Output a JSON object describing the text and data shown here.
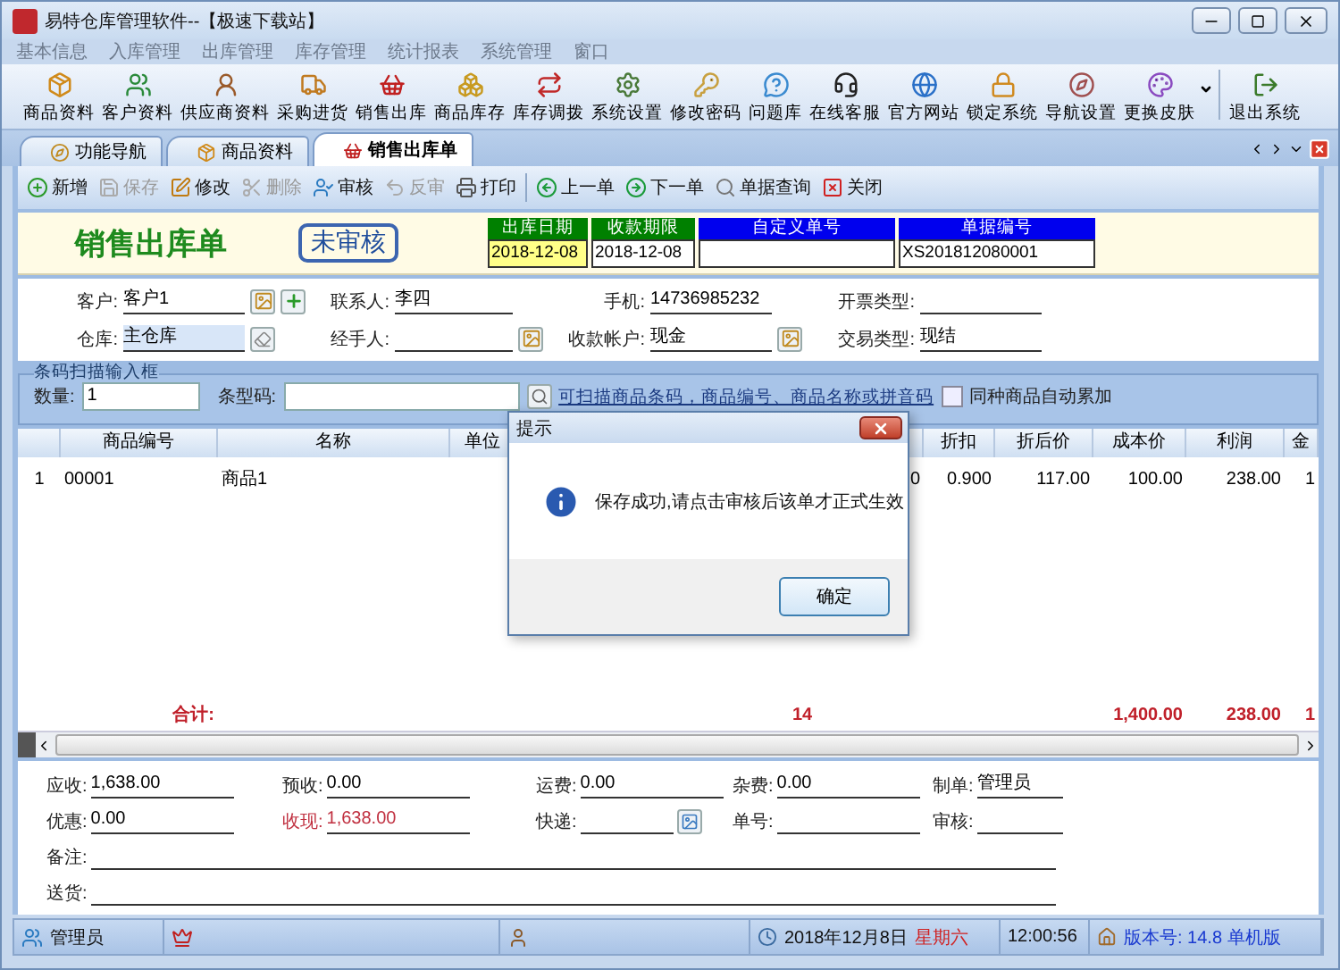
{
  "window": {
    "title": "易特仓库管理软件--【极速下载站】"
  },
  "menu": [
    "基本信息",
    "入库管理",
    "出库管理",
    "库存管理",
    "统计报表",
    "系统管理",
    "窗口"
  ],
  "toolbar_groups": [
    [
      {
        "label": "商品资料",
        "dropdown": false
      },
      {
        "label": "客户资料",
        "dropdown": false
      },
      {
        "label": "供应商资料",
        "dropdown": false
      },
      {
        "label": "采购进货",
        "dropdown": false
      },
      {
        "label": "销售出库",
        "dropdown": false
      },
      {
        "label": "商品库存",
        "dropdown": false
      },
      {
        "label": "库存调拨",
        "dropdown": false
      },
      {
        "label": "系统设置",
        "dropdown": false
      },
      {
        "label": "修改密码",
        "dropdown": false
      },
      {
        "label": "问题库",
        "dropdown": false
      },
      {
        "label": "在线客服",
        "dropdown": false
      },
      {
        "label": "官方网站",
        "dropdown": false
      },
      {
        "label": "锁定系统",
        "dropdown": false
      },
      {
        "label": "导航设置",
        "dropdown": false
      },
      {
        "label": "更换皮肤",
        "dropdown": true
      }
    ],
    [
      {
        "label": "退出系统",
        "dropdown": false
      }
    ]
  ],
  "tabs": [
    {
      "label": "功能导航",
      "selected": false
    },
    {
      "label": "商品资料",
      "selected": false
    },
    {
      "label": "销售出库单",
      "selected": true
    }
  ],
  "action_groups": [
    [
      {
        "label": "新增",
        "disabled": false
      },
      {
        "label": "保存",
        "disabled": true
      },
      {
        "label": "修改",
        "disabled": false
      },
      {
        "label": "删除",
        "disabled": true
      },
      {
        "label": "审核",
        "disabled": false
      },
      {
        "label": "反审",
        "disabled": true
      },
      {
        "label": "打印",
        "disabled": false
      }
    ],
    [
      {
        "label": "上一单",
        "disabled": false
      },
      {
        "label": "下一单",
        "disabled": false
      },
      {
        "label": "单据查询",
        "disabled": false
      },
      {
        "label": "关闭",
        "disabled": false
      }
    ]
  ],
  "form_title": "销售出库单",
  "stamp": "未审核",
  "header_fields": [
    {
      "label": "出库日期",
      "color": "#008000",
      "value": "2018-12-08",
      "focused": true
    },
    {
      "label": "收款期限",
      "color": "#008000",
      "value": "2018-12-08",
      "focused": false
    },
    {
      "label": "自定义单号",
      "color": "#0000ee",
      "focused": false
    },
    {
      "label": "单据编号",
      "color": "#0000ee",
      "value": "XS201812080001",
      "focused": false
    }
  ],
  "info_rows": [
    [
      {
        "label": "客户:",
        "value": "客户1",
        "highlighted": false
      },
      {
        "label": "联系人:",
        "value": "李四",
        "highlighted": false
      },
      {
        "label": "手机:",
        "value": "14736985232",
        "highlighted": false
      },
      {
        "label": "开票类型:",
        "highlighted": false
      }
    ],
    [
      {
        "label": "仓库:",
        "value": "主仓库",
        "highlighted": true
      },
      {
        "label": "经手人:",
        "highlighted": false
      },
      {
        "label": "收款帐户:",
        "value": "现金",
        "highlighted": false
      },
      {
        "label": "交易类型:",
        "value": "现结",
        "highlighted": false
      }
    ]
  ],
  "barcode": {
    "legend": "条码扫描输入框",
    "quantity_label": "数量:",
    "quantity": "1",
    "code_label": "条型码:",
    "hint": "可扫描商品条码，商品编号、商品名称或拼音码",
    "auto_merge": {
      "label": "同种商品自动累加",
      "checked": false
    }
  },
  "table": {
    "columns": [
      "商品编号",
      "名称",
      "单位",
      "折扣",
      "折后价",
      "成本价",
      "利润",
      "金"
    ],
    "rows": [
      {
        "number": "1",
        "cells": [
          "00001",
          "商品1"
        ],
        "trailing_cells": [
          "0",
          "0.900",
          "117.00",
          "100.00",
          "238.00",
          "1"
        ]
      }
    ],
    "totals": {
      "label": "合计:",
      "column_6": "14",
      "trailing_cells": [
        "1,400.00",
        "238.00",
        "1"
      ]
    }
  },
  "summary_rows": [
    [
      {
        "label": "应收:",
        "value": "1,638.00",
        "alert": false
      },
      {
        "label": "预收:",
        "value": "0.00",
        "alert": false
      },
      {
        "label": "运费:",
        "value": "0.00",
        "alert": false
      },
      {
        "label": "杂费:",
        "value": "0.00",
        "alert": false
      },
      {
        "label": "制单:",
        "value": "管理员",
        "alert": false
      }
    ],
    [
      {
        "label": "优惠:",
        "value": "0.00",
        "alert": false
      },
      {
        "label": "收现:",
        "value": "1,638.00",
        "alert": true
      },
      {
        "label": "快递:",
        "alert": false,
        "button": true
      },
      {
        "label": "单号:",
        "alert": false
      },
      {
        "label": "审核:",
        "alert": false
      }
    ]
  ],
  "notes": [
    {
      "label": "备注:"
    },
    {
      "label": "送货:"
    }
  ],
  "dialog": {
    "title": "提示",
    "message": "保存成功,请点击审核后该单才正式生效",
    "button": "确定"
  },
  "status_bar": {
    "user": "管理员",
    "date": "2018年12月8日",
    "weekday": "星期六",
    "time": "12:00:56",
    "version": "版本号: 14.8 单机版"
  }
}
